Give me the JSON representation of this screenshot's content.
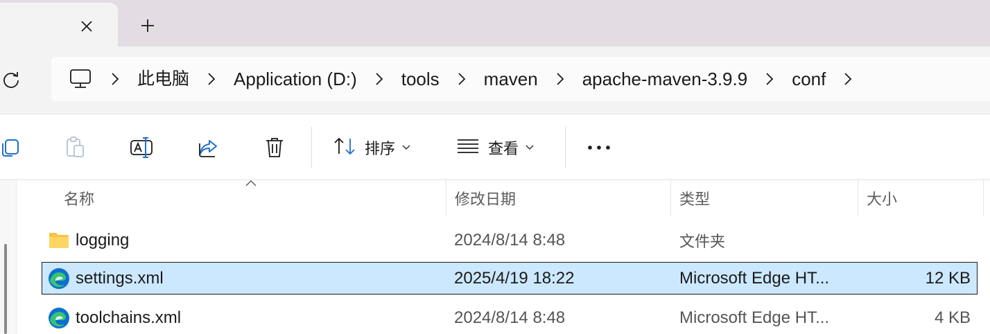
{
  "tabs": {
    "close_icon": "close-icon",
    "new_tab_icon": "plus-icon"
  },
  "address": {
    "root_icon": "this-pc-icon",
    "crumbs": [
      "此电脑",
      "Application (D:)",
      "tools",
      "maven",
      "apache-maven-3.9.9",
      "conf"
    ]
  },
  "commands": {
    "sort_label": "排序",
    "view_label": "查看"
  },
  "columns": {
    "name": "名称",
    "date": "修改日期",
    "type": "类型",
    "size": "大小"
  },
  "files": [
    {
      "name": "logging",
      "icon": "folder-icon",
      "date": "2024/8/14 8:48",
      "type": "文件夹",
      "size": "",
      "selected": false
    },
    {
      "name": "settings.xml",
      "icon": "edge-icon",
      "date": "2025/4/19 18:22",
      "type": "Microsoft Edge HT...",
      "size": "12 KB",
      "selected": true
    },
    {
      "name": "toolchains.xml",
      "icon": "edge-icon",
      "date": "2024/8/14 8:48",
      "type": "Microsoft Edge HT...",
      "size": "4 KB",
      "selected": false
    }
  ],
  "colors": {
    "tabstrip": "#e3dde3",
    "selection": "#cce8ff",
    "folder": "#f8c340",
    "edge_blue": "#0c6fd0",
    "edge_green": "#39c275"
  }
}
